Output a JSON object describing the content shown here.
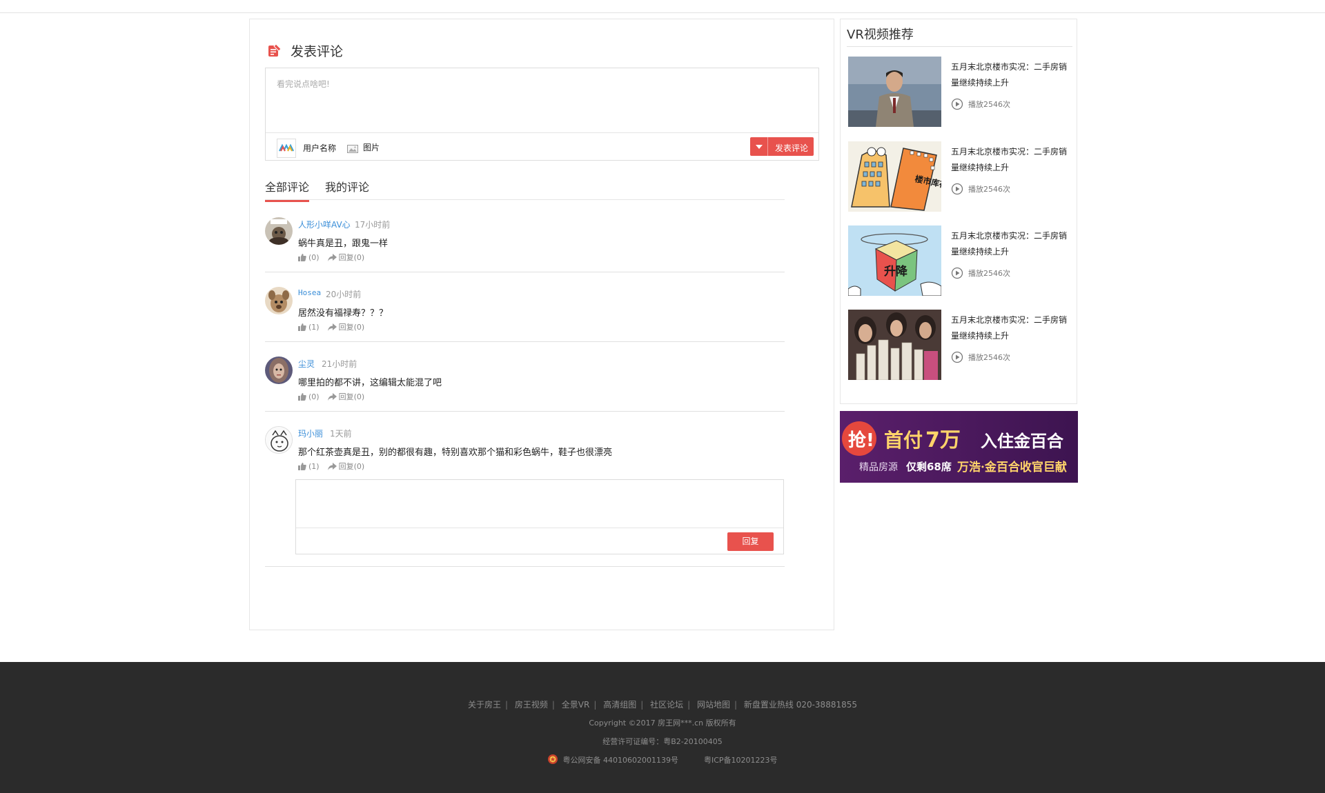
{
  "post": {
    "title": "发表评论",
    "placeholder": "看完说点啥吧!",
    "user_name": "用户名称",
    "picture_label": "图片",
    "submit_label": "发表评论"
  },
  "tabs": [
    {
      "label": "全部评论",
      "active": true
    },
    {
      "label": "我的评论",
      "active": false
    }
  ],
  "comments": [
    {
      "user": "人形小咩AV心",
      "time": "17小时前",
      "text": "蜗牛真是丑，跟鬼一样",
      "likes": "(0)",
      "reply": "回复(0)"
    },
    {
      "user": "Hosea",
      "time": "20小时前",
      "text": "居然没有福禄寿？？？",
      "likes": "(1)",
      "reply": "回复(0)"
    },
    {
      "user": "尘灵",
      "time": "21小时前",
      "text": "哪里拍的都不讲，这编辑太能混了吧",
      "likes": "(0)",
      "reply": "回复(0)"
    },
    {
      "user": "玛小丽",
      "time": "1天前",
      "text": "那个红茶壶真是丑，别的都很有趣，特别喜欢那个猫和彩色蜗牛，鞋子也很漂亮",
      "likes": "(1)",
      "reply": "回复(0)"
    }
  ],
  "reply_box": {
    "button_label": "回复"
  },
  "sidebar": {
    "title": "VR视频推荐",
    "videos": [
      {
        "title": "五月末北京楼市实况：二手房销量继续持续上升",
        "plays": "播放2546次"
      },
      {
        "title": "五月末北京楼市实况：二手房销量继续持续上升",
        "plays": "播放2546次"
      },
      {
        "title": "五月末北京楼市实况：二手房销量继续持续上升",
        "plays": "播放2546次"
      },
      {
        "title": "五月末北京楼市实况：二手房销量继续持续上升",
        "plays": "播放2546次"
      }
    ],
    "thumb_captions": [
      "楼市库存",
      "升降"
    ]
  },
  "ad": {
    "grab": "抢!",
    "headline_a": "首付",
    "headline_b": "7万",
    "headline_c": "入住金百合",
    "sub_a": "精品房源",
    "sub_b": "仅剩68席",
    "sub_c": "万浩·金百合收官巨献"
  },
  "footer": {
    "links": [
      "关于房王",
      "房王视频",
      "全景VR",
      "高清组图",
      "社区论坛",
      "网站地图",
      "新盘置业热线 020-38881855"
    ],
    "copyright": "Copyright ©2017 房王网***.cn 版权所有",
    "license": "经营许可证编号：粤B2-20100405",
    "police": "粤公网安备 44010602001139号",
    "icp": "粤ICP备10201223号"
  },
  "colors": {
    "accent": "#e8524d",
    "link": "#3a8ed8",
    "footer_bg": "#2b2b2b"
  }
}
